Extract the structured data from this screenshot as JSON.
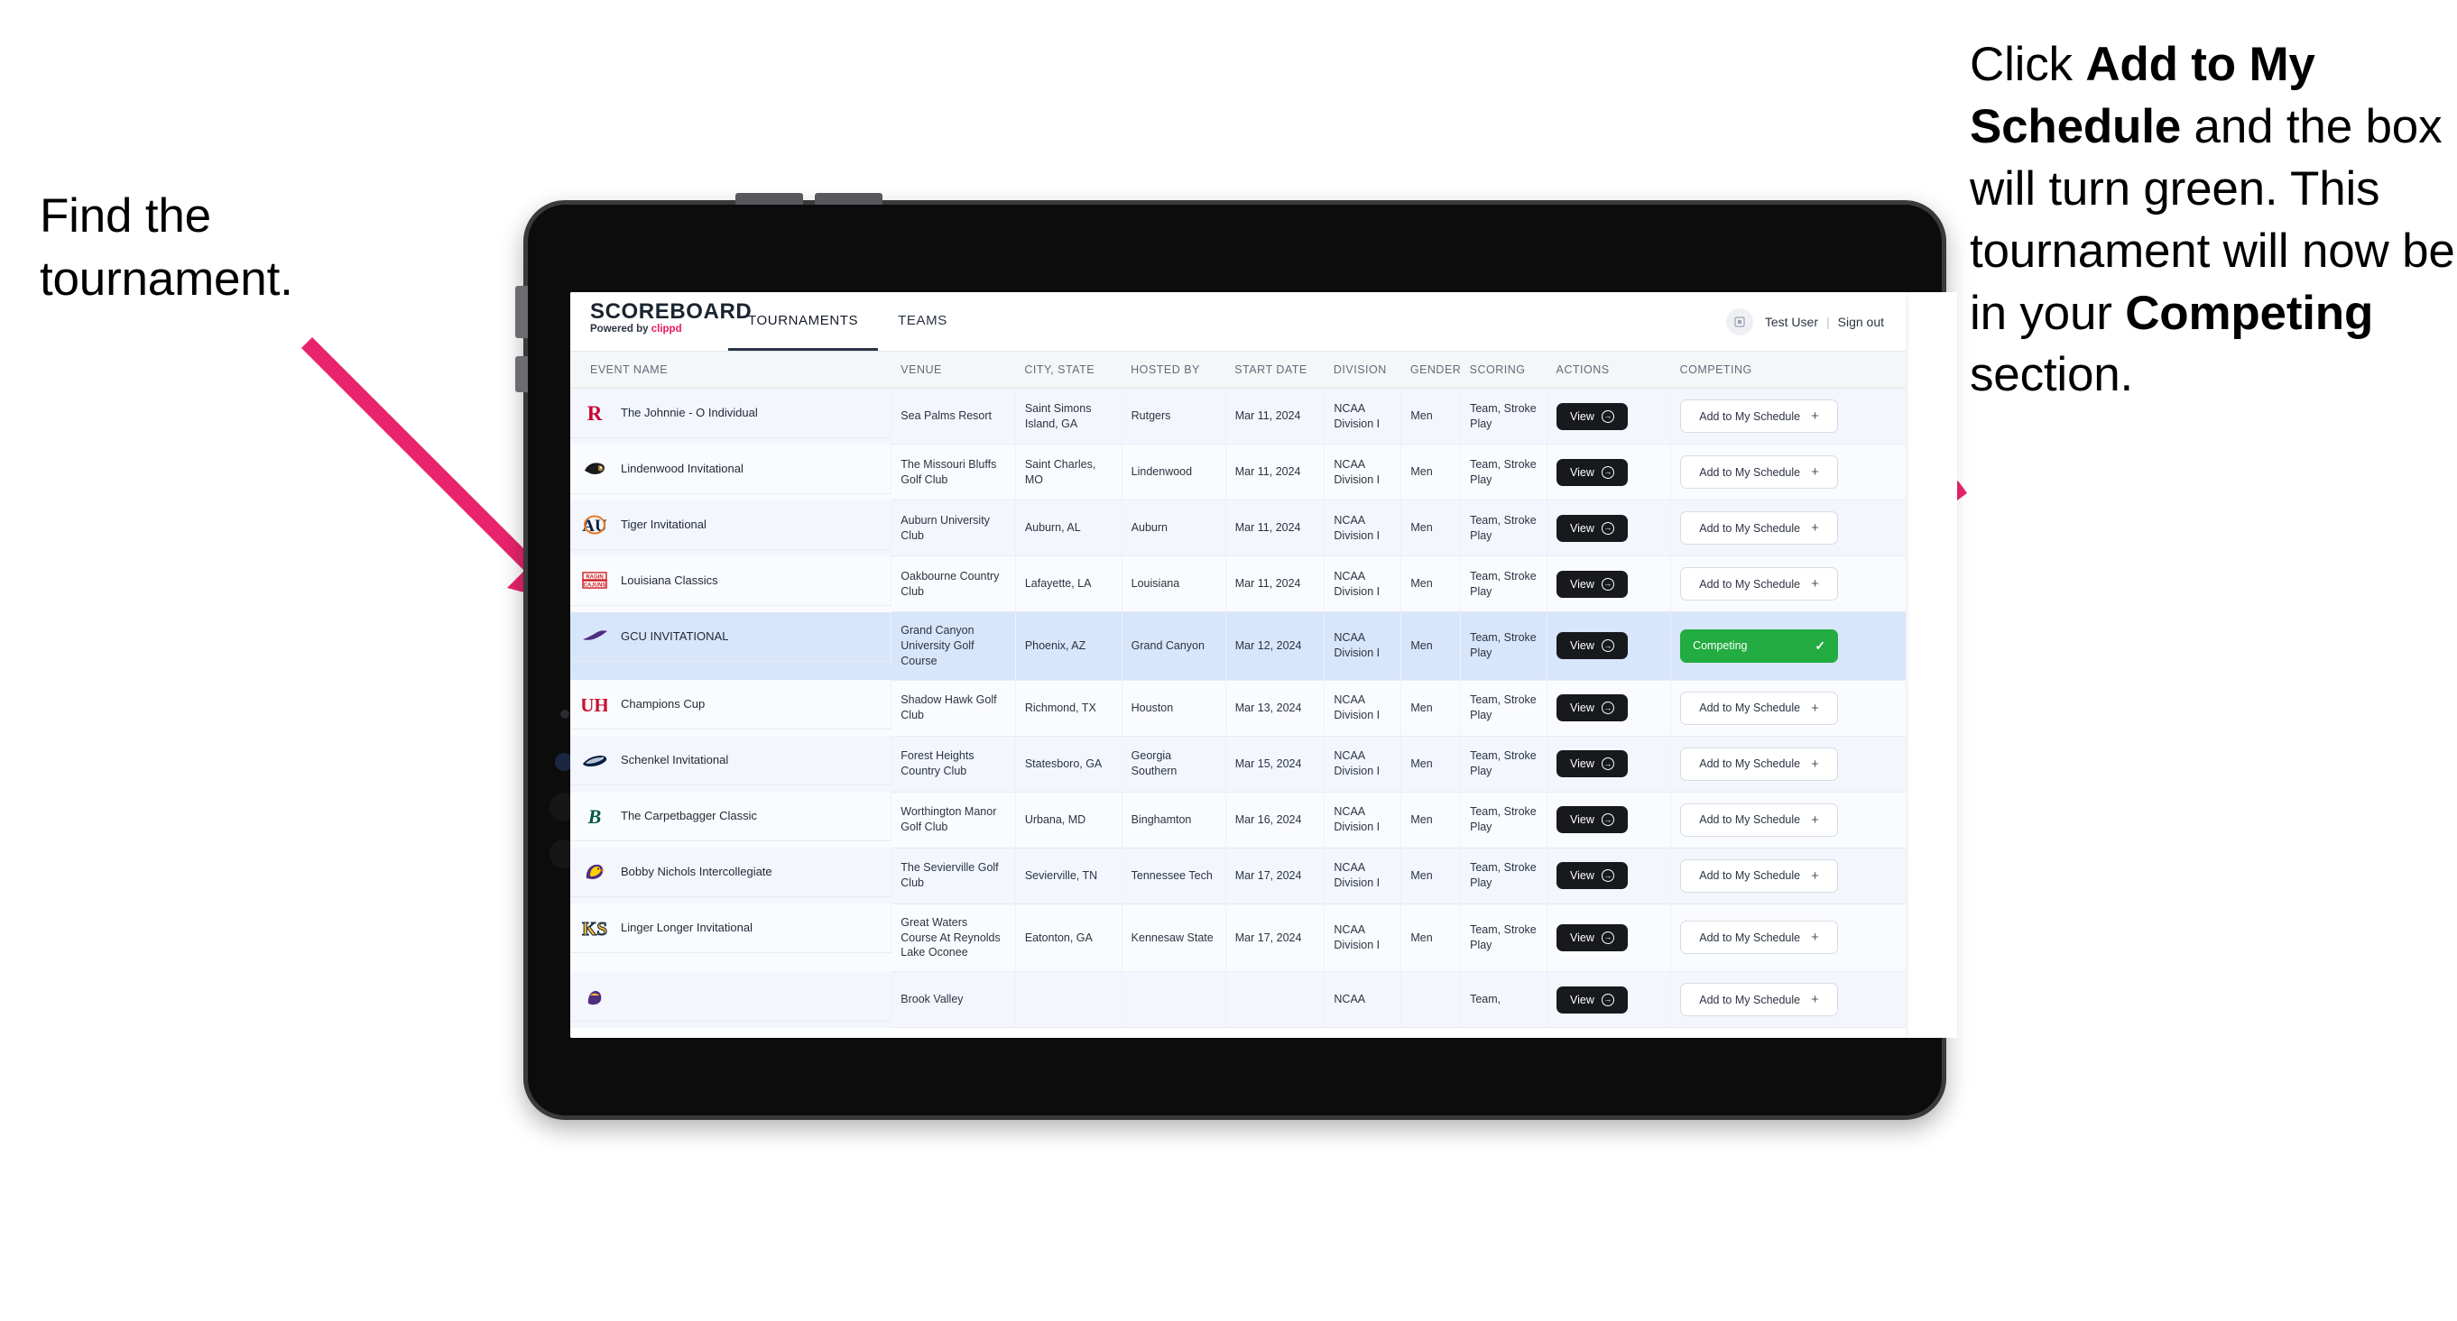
{
  "annotations": {
    "left": {
      "line1": "Find the",
      "line2": "tournament."
    },
    "right": {
      "seg1": "Click ",
      "bold1": "Add to My Schedule",
      "seg2": " and the box will turn green. This tournament will now be in your ",
      "bold2": "Competing",
      "seg3": " section."
    },
    "arrow_color": "#E8246C"
  },
  "app": {
    "brand": {
      "title": "SCOREBOARD",
      "powered_prefix": "Powered by ",
      "powered_name": "clippd"
    },
    "tabs": [
      {
        "label": "TOURNAMENTS",
        "active": true
      },
      {
        "label": "TEAMS",
        "active": false
      }
    ],
    "user": {
      "avatar_icon": "user-avatar-icon",
      "name": "Test User",
      "separator": "|",
      "signout": "Sign out"
    },
    "table": {
      "columns": [
        "EVENT NAME",
        "VENUE",
        "CITY, STATE",
        "HOSTED BY",
        "START DATE",
        "DIVISION",
        "GENDER",
        "SCORING",
        "ACTIONS",
        "COMPETING"
      ],
      "view_label": "View",
      "add_label": "Add to My Schedule",
      "add_icon": "plus-icon",
      "competing_label": "Competing",
      "competing_icon": "check-icon",
      "view_icon": "arrow-right-circle-icon",
      "competing_color": "#22ac41",
      "highlight_row_color": "#d8e6fb",
      "rows": [
        {
          "logo": "rutgers-r-logo",
          "event": "The Johnnie - O Individual",
          "venue": "Sea Palms Resort",
          "city": "Saint Simons Island, GA",
          "host": "Rutgers",
          "date": "Mar 11, 2024",
          "division": "NCAA Division I",
          "gender": "Men",
          "scoring": "Team, Stroke Play",
          "competing": false
        },
        {
          "logo": "lindenwood-lion-logo",
          "event": "Lindenwood Invitational",
          "venue": "The Missouri Bluffs Golf Club",
          "city": "Saint Charles, MO",
          "host": "Lindenwood",
          "date": "Mar 11, 2024",
          "division": "NCAA Division I",
          "gender": "Men",
          "scoring": "Team, Stroke Play",
          "competing": false
        },
        {
          "logo": "auburn-au-logo",
          "event": "Tiger Invitational",
          "venue": "Auburn University Club",
          "city": "Auburn, AL",
          "host": "Auburn",
          "date": "Mar 11, 2024",
          "division": "NCAA Division I",
          "gender": "Men",
          "scoring": "Team, Stroke Play",
          "competing": false
        },
        {
          "logo": "ragin-cajuns-logo",
          "event": "Louisiana Classics",
          "venue": "Oakbourne Country Club",
          "city": "Lafayette, LA",
          "host": "Louisiana",
          "date": "Mar 11, 2024",
          "division": "NCAA Division I",
          "gender": "Men",
          "scoring": "Team, Stroke Play",
          "competing": false
        },
        {
          "logo": "gcu-lope-logo",
          "event": "GCU INVITATIONAL",
          "venue": "Grand Canyon University Golf Course",
          "city": "Phoenix, AZ",
          "host": "Grand Canyon",
          "date": "Mar 12, 2024",
          "division": "NCAA Division I",
          "gender": "Men",
          "scoring": "Team, Stroke Play",
          "competing": true
        },
        {
          "logo": "houston-uh-logo",
          "event": "Champions Cup",
          "venue": "Shadow Hawk Golf Club",
          "city": "Richmond, TX",
          "host": "Houston",
          "date": "Mar 13, 2024",
          "division": "NCAA Division I",
          "gender": "Men",
          "scoring": "Team, Stroke Play",
          "competing": false
        },
        {
          "logo": "georgia-southern-eagle-logo",
          "event": "Schenkel Invitational",
          "venue": "Forest Heights Country Club",
          "city": "Statesboro, GA",
          "host": "Georgia Southern",
          "date": "Mar 15, 2024",
          "division": "NCAA Division I",
          "gender": "Men",
          "scoring": "Team, Stroke Play",
          "competing": false
        },
        {
          "logo": "binghamton-b-logo",
          "event": "The Carpetbagger Classic",
          "venue": "Worthington Manor Golf Club",
          "city": "Urbana, MD",
          "host": "Binghamton",
          "date": "Mar 16, 2024",
          "division": "NCAA Division I",
          "gender": "Men",
          "scoring": "Team, Stroke Play",
          "competing": false
        },
        {
          "logo": "tennessee-tech-eagle-logo",
          "event": "Bobby Nichols Intercollegiate",
          "venue": "The Sevierville Golf Club",
          "city": "Sevierville, TN",
          "host": "Tennessee Tech",
          "date": "Mar 17, 2024",
          "division": "NCAA Division I",
          "gender": "Men",
          "scoring": "Team, Stroke Play",
          "competing": false
        },
        {
          "logo": "kennesaw-state-ks-logo",
          "event": "Linger Longer Invitational",
          "venue": "Great Waters Course At Reynolds Lake Oconee",
          "city": "Eatonton, GA",
          "host": "Kennesaw State",
          "date": "Mar 17, 2024",
          "division": "NCAA Division I",
          "gender": "Men",
          "scoring": "Team, Stroke Play",
          "competing": false
        },
        {
          "logo": "ecu-pirate-logo",
          "event": "",
          "venue": "Brook Valley",
          "city": "",
          "host": "",
          "date": "",
          "division": "NCAA",
          "gender": "",
          "scoring": "Team,",
          "competing": false
        }
      ]
    }
  }
}
